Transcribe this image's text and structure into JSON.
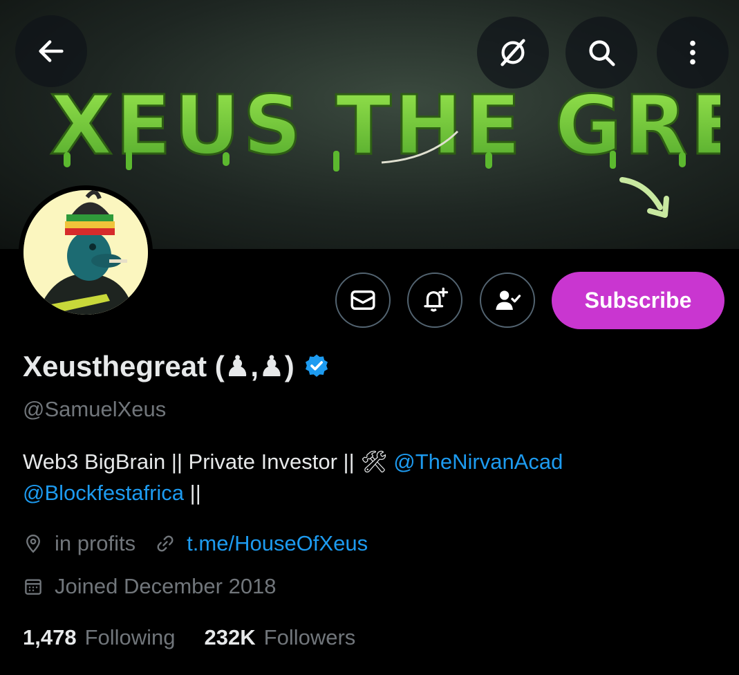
{
  "banner": {
    "title_text": "XEUS THE GREAT",
    "colors": {
      "slime": "#7dd33d",
      "slime_dark": "#3f8a1c"
    }
  },
  "top_actions": {
    "back_icon": "arrow-left-icon",
    "grok_icon": "grok-slash-circle-icon",
    "search_icon": "search-icon",
    "more_icon": "vertical-dots-icon"
  },
  "actions": {
    "message_icon": "envelope-icon",
    "notify_icon": "bell-plus-icon",
    "following_icon": "person-check-icon",
    "subscribe_label": "Subscribe"
  },
  "profile": {
    "display_name": "Xeusthegreat (♟,♟)",
    "verified": true,
    "handle": "@SamuelXeus",
    "bio_text_1": "Web3 BigBrain || Private Investor || 🛠",
    "bio_mention_1": "@TheNirvanAcad",
    "bio_mention_2": "@Blockfestafrica",
    "bio_text_2": "||",
    "location": "in profits",
    "website": "t.me/HouseOfXeus",
    "joined": "Joined December 2018"
  },
  "stats": {
    "following_count": "1,478",
    "following_label": "Following",
    "followers_count": "232K",
    "followers_label": "Followers"
  },
  "colors": {
    "background": "#000000",
    "text_primary": "#e7e9ea",
    "text_secondary": "#71767b",
    "link": "#1d9bf0",
    "subscribe": "#c936d0",
    "verified": "#1d9bf0"
  }
}
